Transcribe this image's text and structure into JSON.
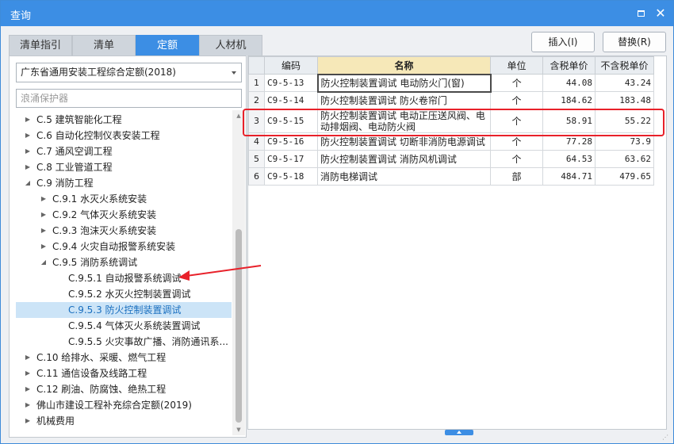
{
  "window": {
    "title": "查询",
    "restore_icon": "restore-icon",
    "close_icon": "close-icon",
    "close_glyph": "✕"
  },
  "tabs": [
    {
      "label": "清单指引",
      "active": false
    },
    {
      "label": "清单",
      "active": false
    },
    {
      "label": "定额",
      "active": true
    },
    {
      "label": "人材机",
      "active": false
    }
  ],
  "actions": {
    "insert_label": "插入(I)",
    "replace_label": "替换(R)"
  },
  "left": {
    "library_select": "广东省通用安装工程综合定额(2018)",
    "search_value": "浪涌保护器",
    "tree": [
      {
        "label": "C.5 建筑智能化工程",
        "level": 0,
        "state": "collapsed"
      },
      {
        "label": "C.6 自动化控制仪表安装工程",
        "level": 0,
        "state": "collapsed"
      },
      {
        "label": "C.7 通风空调工程",
        "level": 0,
        "state": "collapsed"
      },
      {
        "label": "C.8 工业管道工程",
        "level": 0,
        "state": "collapsed"
      },
      {
        "label": "C.9 消防工程",
        "level": 0,
        "state": "expanded"
      },
      {
        "label": "C.9.1 水灭火系统安装",
        "level": 1,
        "state": "collapsed"
      },
      {
        "label": "C.9.2 气体灭火系统安装",
        "level": 1,
        "state": "collapsed"
      },
      {
        "label": "C.9.3 泡沫灭火系统安装",
        "level": 1,
        "state": "collapsed"
      },
      {
        "label": "C.9.4 火灾自动报警系统安装",
        "level": 1,
        "state": "collapsed"
      },
      {
        "label": "C.9.5 消防系统调试",
        "level": 1,
        "state": "expanded"
      },
      {
        "label": "C.9.5.1 自动报警系统调试",
        "level": 2,
        "state": "leaf"
      },
      {
        "label": "C.9.5.2 水灭火控制装置调试",
        "level": 2,
        "state": "leaf"
      },
      {
        "label": "C.9.5.3 防火控制装置调试",
        "level": 2,
        "state": "leaf",
        "selected": true
      },
      {
        "label": "C.9.5.4 气体灭火系统装置调试",
        "level": 2,
        "state": "leaf"
      },
      {
        "label": "C.9.5.5 火灾事故广播、消防通讯系...",
        "level": 2,
        "state": "leaf"
      },
      {
        "label": "C.10 给排水、采暖、燃气工程",
        "level": 0,
        "state": "collapsed"
      },
      {
        "label": "C.11 通信设备及线路工程",
        "level": 0,
        "state": "collapsed"
      },
      {
        "label": "C.12 刷油、防腐蚀、绝热工程",
        "level": 0,
        "state": "collapsed"
      },
      {
        "label": "佛山市建设工程补充综合定额(2019)",
        "level": 0,
        "state": "collapsed"
      },
      {
        "label": "机械费用",
        "level": 0,
        "state": "collapsed"
      }
    ]
  },
  "grid": {
    "headers": [
      "编码",
      "名称",
      "单位",
      "含税单价",
      "不含税单价"
    ],
    "rows": [
      {
        "idx": "1",
        "code": "C9-5-13",
        "name": "防火控制装置调试 电动防火门(窗)",
        "unit": "个",
        "tax_price": "44.08",
        "notax_price": "43.24"
      },
      {
        "idx": "2",
        "code": "C9-5-14",
        "name": "防火控制装置调试 防火卷帘门",
        "unit": "个",
        "tax_price": "184.62",
        "notax_price": "183.48"
      },
      {
        "idx": "3",
        "code": "C9-5-15",
        "name": "防火控制装置调试 电动正压送风阀、电动排烟阀、电动防火阀",
        "unit": "个",
        "tax_price": "58.91",
        "notax_price": "55.22"
      },
      {
        "idx": "4",
        "code": "C9-5-16",
        "name": "防火控制装置调试 切断非消防电源调试",
        "unit": "个",
        "tax_price": "77.28",
        "notax_price": "73.9"
      },
      {
        "idx": "5",
        "code": "C9-5-17",
        "name": "防火控制装置调试 消防风机调试",
        "unit": "个",
        "tax_price": "64.53",
        "notax_price": "63.62"
      },
      {
        "idx": "6",
        "code": "C9-5-18",
        "name": "消防电梯调试",
        "unit": "部",
        "tax_price": "484.71",
        "notax_price": "479.65"
      }
    ]
  },
  "colors": {
    "accent": "#3c8ee4",
    "highlight": "#e8212a",
    "selected_row": "#cce4f7"
  }
}
